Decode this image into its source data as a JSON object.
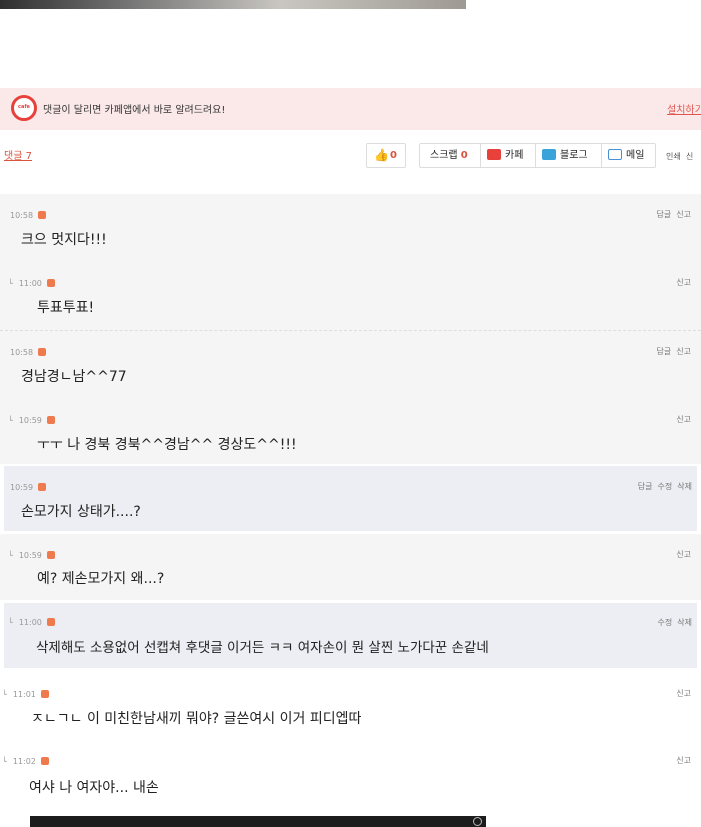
{
  "banner": {
    "logo_text": "cafe",
    "text": "댓글이 달리면 카페앱에서 바로 알려드려요!",
    "install_link": "설치하기"
  },
  "toolbar": {
    "comment_count": "댓글 7",
    "like_count": "0",
    "scrap_label": "스크랩",
    "scrap_count": "0",
    "cafe_label": "카페",
    "blog_label": "블로그",
    "mail_label": "메일",
    "print_label": "인쇄",
    "report_label": "신"
  },
  "colors": {
    "accent": "#e8403a",
    "banner_bg": "#fbe9ea",
    "badge": "#ef7a4e",
    "blog": "#3aa3d9",
    "mail": "#4a90d9"
  },
  "comments": [
    {
      "time": "10:58",
      "text": "크으 멋지다!!!",
      "reply": false,
      "actions": [
        "답글",
        "신고"
      ]
    },
    {
      "time": "11:00",
      "text": "투표투표!",
      "reply": true,
      "actions": [
        "신고"
      ]
    },
    {
      "time": "10:58",
      "text": "경남경ㄴ남^^77",
      "reply": false,
      "actions": [
        "답글",
        "신고"
      ]
    },
    {
      "time": "10:59",
      "text": "ㅜㅜ 나 경북 경북^^경남^^ 경상도^^!!!",
      "reply": true,
      "actions": [
        "신고"
      ]
    },
    {
      "time": "10:59",
      "text": "손모가지 상태가....?",
      "reply": false,
      "actions": [
        "답글",
        "수정",
        "삭제"
      ]
    },
    {
      "time": "10:59",
      "text": "예? 제손모가지 왜...?",
      "reply": true,
      "actions": [
        "신고"
      ]
    },
    {
      "time": "11:00",
      "text": "삭제해도 소용없어 선캡쳐 후댓글 이거든 ㅋㅋ 여자손이 뭔 살찐 노가다꾼 손같네",
      "reply": true,
      "actions": [
        "수정",
        "삭제"
      ]
    },
    {
      "time": "11:01",
      "text": "ㅈㄴㄱㄴ 이 미친한남새끼 뭐야? 글쓴여시 이거 피디엡따",
      "reply": true,
      "actions": [
        "신고"
      ]
    },
    {
      "time": "11:02",
      "text": "여샤 나 여자야... 내손",
      "reply": true,
      "actions": [
        "신고"
      ]
    }
  ]
}
